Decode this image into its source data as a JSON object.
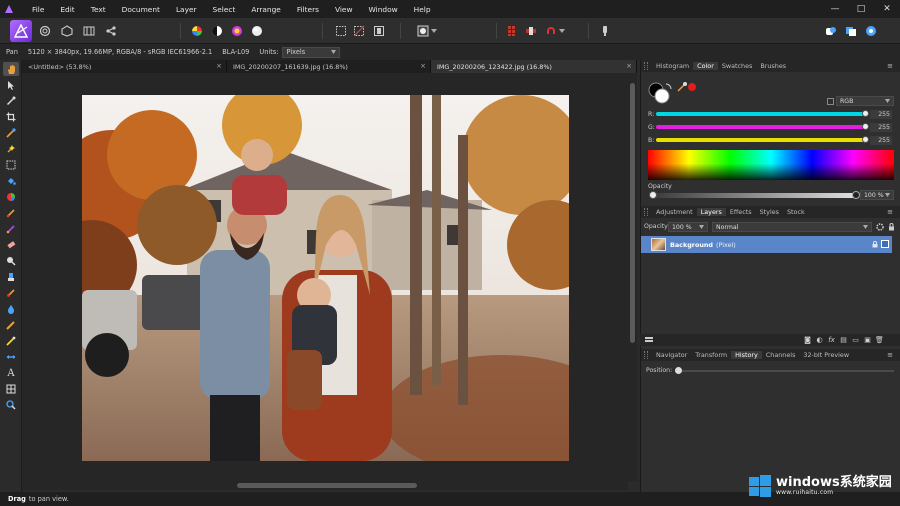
{
  "menubar": {
    "items": [
      "File",
      "Edit",
      "Text",
      "Document",
      "Layer",
      "Select",
      "Arrange",
      "Filters",
      "View",
      "Window",
      "Help"
    ],
    "window_controls": [
      "—",
      "□",
      "✕"
    ]
  },
  "contextbar": {
    "tool_name": "Pan",
    "doc_info": "5120 × 3840px, 19.66MP, RGBA/8 - sRGB IEC61966-2.1",
    "camera": "BLA-L09",
    "units_label": "Units:",
    "units_value": "Pixels"
  },
  "tabs": [
    {
      "label": "<Untitled> (53.8%)",
      "close": "×"
    },
    {
      "label": "IMG_20200207_161639.jpg (16.8%)",
      "close": "×"
    },
    {
      "label": "IMG_20200206_123422.jpg (16.8%)",
      "close": "×"
    }
  ],
  "color_panel": {
    "tabs": [
      "Histogram",
      "Color",
      "Swatches",
      "Brushes"
    ],
    "active_tab": "Color",
    "model": "RGB",
    "channels": [
      {
        "label": "R:",
        "value": "255",
        "color": "#00e0e8"
      },
      {
        "label": "G:",
        "value": "255",
        "color": "#e020e0"
      },
      {
        "label": "B:",
        "value": "255",
        "color": "#e8e000"
      }
    ],
    "opacity_label": "Opacity",
    "opacity_value": "100 %"
  },
  "layers_panel": {
    "tabs": [
      "Adjustment",
      "Layers",
      "Effects",
      "Styles",
      "Stock"
    ],
    "active_tab": "Layers",
    "opacity_label": "Opacity:",
    "opacity_value": "100 %",
    "blend_mode": "Normal",
    "layer_name": "Background",
    "layer_type": "(Pixel)"
  },
  "history_panel": {
    "tabs": [
      "Navigator",
      "Transform",
      "History",
      "Channels",
      "32-bit Preview"
    ],
    "active_tab": "History",
    "position_label": "Position:"
  },
  "statusbar": {
    "bold": "Drag",
    "text": "to pan view."
  },
  "watermark": {
    "title": "windows系统家园",
    "url": "www.ruihaitu.com"
  }
}
